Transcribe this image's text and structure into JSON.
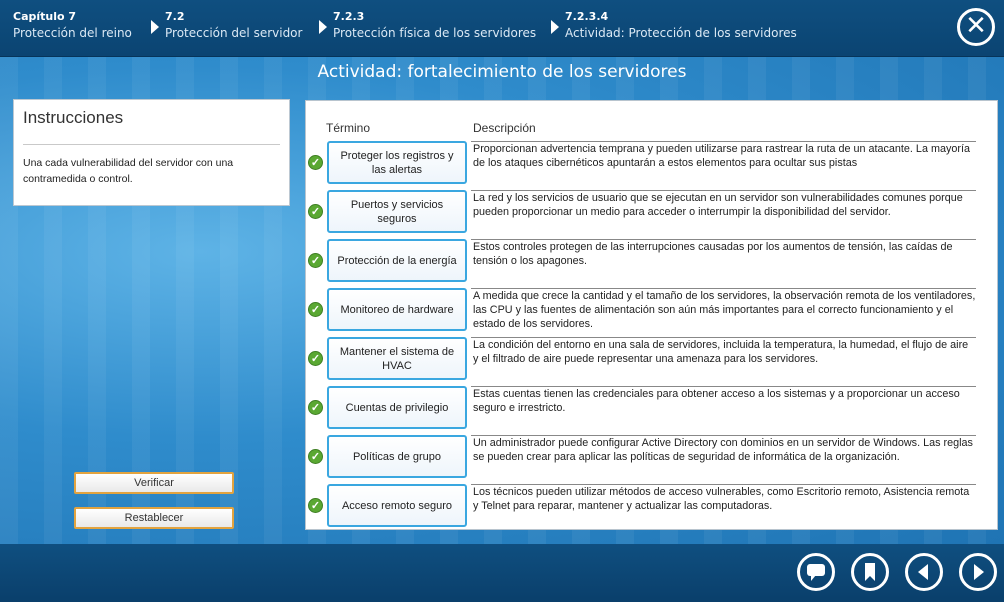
{
  "breadcrumbs": [
    {
      "num": "Capítulo 7",
      "title": "Protección del reino"
    },
    {
      "num": "7.2",
      "title": "Protección del servidor"
    },
    {
      "num": "7.2.3",
      "title": "Protección física de los servidores"
    },
    {
      "num": "7.2.3.4",
      "title": "Actividad: Protección de los servidores"
    }
  ],
  "activity_title": "Actividad: fortalecimiento de los servidores",
  "instructions": {
    "heading": "Instrucciones",
    "text": "Una cada vulnerabilidad del servidor con una contramedida o control."
  },
  "buttons": {
    "verify": "Verificar",
    "reset": "Restablecer"
  },
  "table": {
    "term_header": "Término",
    "desc_header": "Descripción",
    "rows": [
      {
        "term": "Proteger los registros y las alertas",
        "desc": "Proporcionan advertencia temprana y pueden utilizarse para rastrear la ruta de un atacante. La mayoría de los ataques cibernéticos apuntarán a estos elementos para ocultar sus pistas",
        "correct": true
      },
      {
        "term": "Puertos y servicios seguros",
        "desc": "La red y los servicios de usuario que se ejecutan en un servidor son vulnerabilidades comunes porque pueden proporcionar un medio para acceder o interrumpir la disponibilidad del servidor.",
        "correct": true
      },
      {
        "term": "Protección de la energía",
        "desc": "Estos controles protegen de las interrupciones causadas por los aumentos de tensión, las caídas de tensión o los apagones.",
        "correct": true
      },
      {
        "term": "Monitoreo de hardware",
        "desc": "A medida que crece la cantidad y el tamaño de los servidores, la observación remota de los ventiladores, las CPU y las fuentes de alimentación son aún más importantes para el correcto funcionamiento y el estado de los servidores.",
        "correct": true
      },
      {
        "term": "Mantener el sistema de HVAC",
        "desc": "La condición del entorno en una sala de servidores, incluida la temperatura, la humedad, el flujo de aire y el filtrado de aire puede representar una amenaza para los servidores.",
        "correct": true
      },
      {
        "term": "Cuentas de privilegio",
        "desc": "Estas cuentas tienen las credenciales para obtener acceso a los sistemas y a proporcionar un acceso seguro e irrestricto.",
        "correct": true
      },
      {
        "term": "Políticas de grupo",
        "desc": "Un administrador puede configurar Active Directory con dominios en un servidor de Windows. Las reglas se pueden crear para aplicar las políticas de seguridad de informática de la organización.",
        "correct": true
      },
      {
        "term": "Acceso remoto seguro",
        "desc": "Los técnicos pueden utilizar métodos de acceso vulnerables, como Escritorio remoto, Asistencia remota y Telnet para reparar, mantener y actualizar las computadoras.",
        "correct": true
      }
    ]
  },
  "icons": {
    "close": "close-icon",
    "check": "check-icon",
    "comment": "comment-icon",
    "bookmark": "bookmark-icon",
    "back": "back-arrow-icon",
    "next": "next-arrow-icon"
  },
  "colors": {
    "accent_blue": "#3aa7e0",
    "check_green": "#5aa832",
    "button_border": "#e2a33f",
    "bar": "#0f4f80"
  }
}
